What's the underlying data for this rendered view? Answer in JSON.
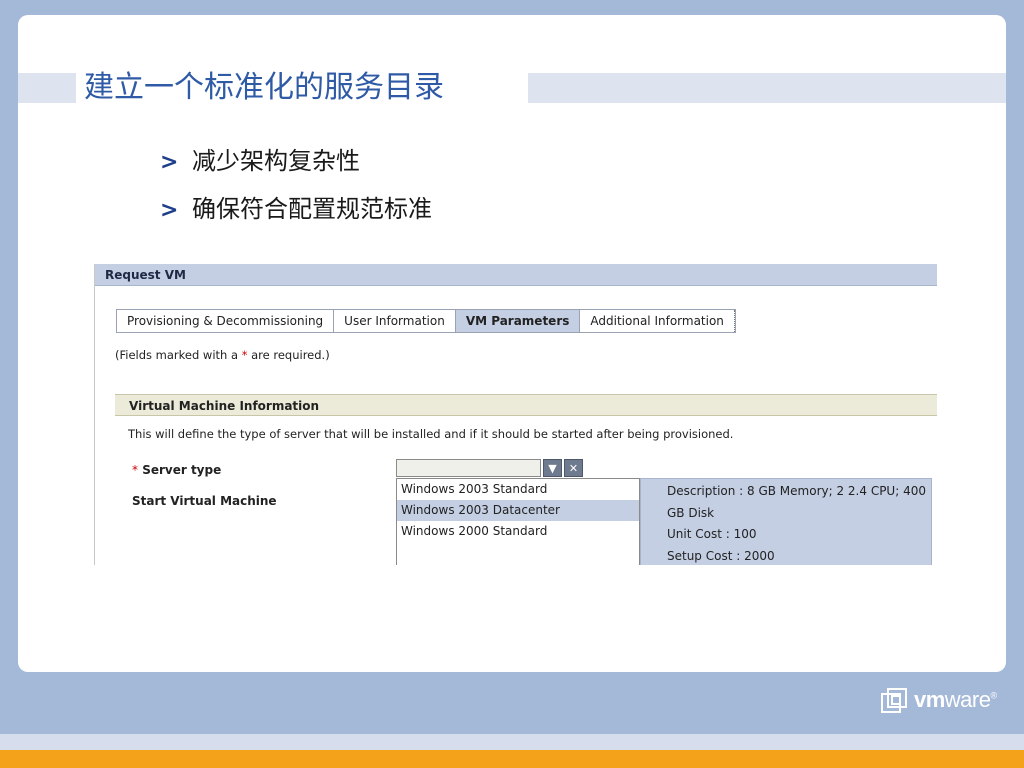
{
  "slide": {
    "title": "建立一个标准化的服务目录",
    "bullets": [
      "减少架构复杂性",
      "确保符合配置规范标准"
    ],
    "bullet_marker": ">"
  },
  "request_vm": {
    "header": "Request VM",
    "tabs": [
      {
        "label": "Provisioning & Decommissioning",
        "active": false
      },
      {
        "label": "User Information",
        "active": false
      },
      {
        "label": "VM Parameters",
        "active": true
      },
      {
        "label": "Additional Information",
        "active": false
      }
    ],
    "required_note": {
      "prefix": "(Fields marked with a ",
      "star": "*",
      "suffix": " are required.)"
    },
    "section": {
      "title": "Virtual Machine Information",
      "description": "This will define the type of server that will be installed and if it should be started after being provisioned."
    },
    "fields": {
      "server_type": {
        "required_star": "*",
        "label": "Server type",
        "value": ""
      },
      "start_vm": {
        "label": "Start Virtual Machine"
      }
    },
    "dropdown": {
      "options": [
        "Windows 2003 Standard",
        "Windows 2003 Datacenter",
        "Windows 2000 Standard"
      ],
      "selected_index": 1
    },
    "details": [
      "Description : 8 GB Memory; 2 2.4 CPU; 400",
      "GB Disk",
      "Unit Cost : 100",
      "Setup Cost : 2000"
    ],
    "icons": {
      "dropdown": "chevron-down-icon",
      "clear": "close-icon"
    }
  },
  "brand": {
    "logo_bold": "vm",
    "logo_light": "ware",
    "logo_mark": "®"
  },
  "colors": {
    "background": "#a4b8d8",
    "title": "#2f5aa6",
    "active_tab": "#c4cfe3",
    "orange_stripe": "#f5a21b"
  }
}
